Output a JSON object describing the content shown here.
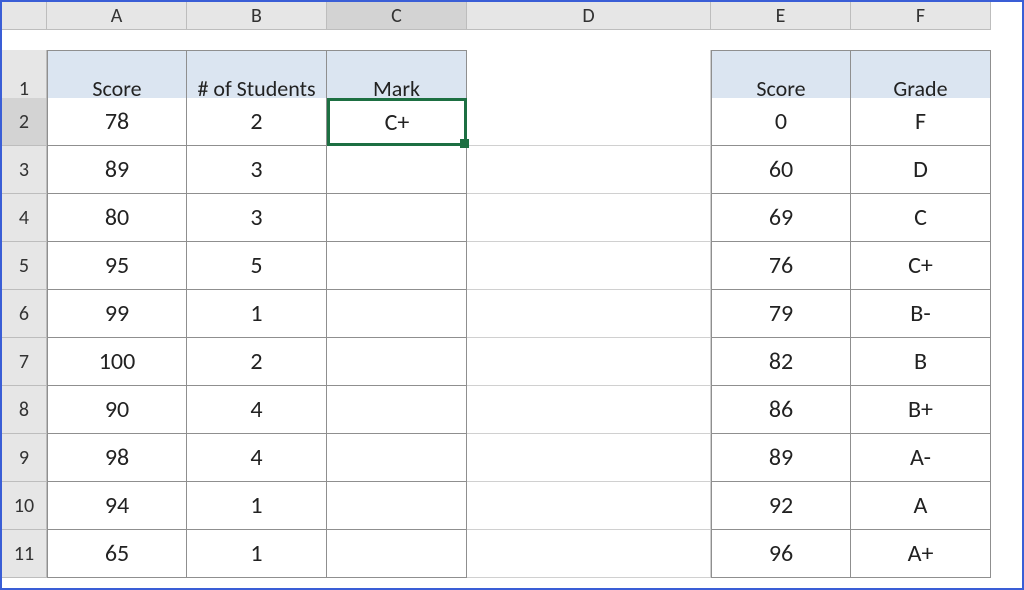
{
  "columns": [
    "A",
    "B",
    "C",
    "D",
    "E",
    "F"
  ],
  "rows": [
    "1",
    "2",
    "3",
    "4",
    "5",
    "6",
    "7",
    "8",
    "9",
    "10",
    "11"
  ],
  "active_cell": "C2",
  "table1": {
    "headers": {
      "A": "Score",
      "B": "# of Students",
      "C": "Mark"
    },
    "rows": [
      {
        "A": "78",
        "B": "2",
        "C": "C+"
      },
      {
        "A": "89",
        "B": "3",
        "C": ""
      },
      {
        "A": "80",
        "B": "3",
        "C": ""
      },
      {
        "A": "95",
        "B": "5",
        "C": ""
      },
      {
        "A": "99",
        "B": "1",
        "C": ""
      },
      {
        "A": "100",
        "B": "2",
        "C": ""
      },
      {
        "A": "90",
        "B": "4",
        "C": ""
      },
      {
        "A": "98",
        "B": "4",
        "C": ""
      },
      {
        "A": "94",
        "B": "1",
        "C": ""
      },
      {
        "A": "65",
        "B": "1",
        "C": ""
      }
    ]
  },
  "table2": {
    "headers": {
      "E": "Score",
      "F": "Grade"
    },
    "rows": [
      {
        "E": "0",
        "F": "F"
      },
      {
        "E": "60",
        "F": "D"
      },
      {
        "E": "69",
        "F": "C"
      },
      {
        "E": "76",
        "F": "C+"
      },
      {
        "E": "79",
        "F": "B-"
      },
      {
        "E": "82",
        "F": "B"
      },
      {
        "E": "86",
        "F": "B+"
      },
      {
        "E": "89",
        "F": "A-"
      },
      {
        "E": "92",
        "F": "A"
      },
      {
        "E": "96",
        "F": "A+"
      }
    ]
  },
  "chart_data": [
    {
      "type": "table",
      "title": "Score / # of Students / Mark",
      "columns": [
        "Score",
        "# of Students",
        "Mark"
      ],
      "rows": [
        [
          78,
          2,
          "C+"
        ],
        [
          89,
          3,
          ""
        ],
        [
          80,
          3,
          ""
        ],
        [
          95,
          5,
          ""
        ],
        [
          99,
          1,
          ""
        ],
        [
          100,
          2,
          ""
        ],
        [
          90,
          4,
          ""
        ],
        [
          98,
          4,
          ""
        ],
        [
          94,
          1,
          ""
        ],
        [
          65,
          1,
          ""
        ]
      ]
    },
    {
      "type": "table",
      "title": "Score / Grade",
      "columns": [
        "Score",
        "Grade"
      ],
      "rows": [
        [
          0,
          "F"
        ],
        [
          60,
          "D"
        ],
        [
          69,
          "C"
        ],
        [
          76,
          "C+"
        ],
        [
          79,
          "B-"
        ],
        [
          82,
          "B"
        ],
        [
          86,
          "B+"
        ],
        [
          89,
          "A-"
        ],
        [
          92,
          "A"
        ],
        [
          96,
          "A+"
        ]
      ]
    }
  ]
}
